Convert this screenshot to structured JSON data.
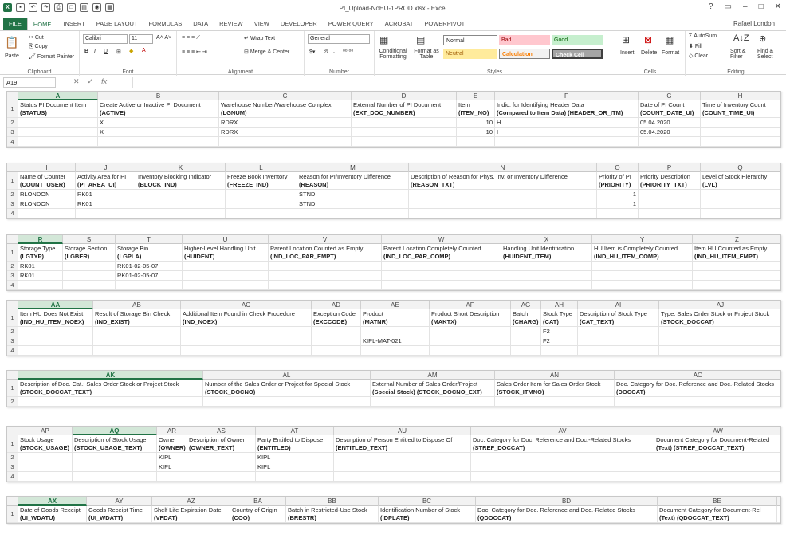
{
  "window": {
    "title": "PI_Upload-NoHU-1PROD.xlsx - Excel",
    "user": "Rafael London",
    "controls": [
      "?",
      "▭",
      "–",
      "□",
      "✕"
    ]
  },
  "tabs": [
    "FILE",
    "HOME",
    "INSERT",
    "PAGE LAYOUT",
    "FORMULAS",
    "DATA",
    "REVIEW",
    "VIEW",
    "DEVELOPER",
    "POWER QUERY",
    "ACROBAT",
    "POWERPIVOT"
  ],
  "active_tab": "HOME",
  "ribbon": {
    "clipboard": {
      "paste": "Paste",
      "cut": "Cut",
      "copy": "Copy",
      "format_painter": "Format Painter",
      "label": "Clipboard"
    },
    "font": {
      "name": "Calibri",
      "size": "11",
      "label": "Font"
    },
    "alignment": {
      "wrap": "Wrap Text",
      "merge": "Merge & Center",
      "label": "Alignment"
    },
    "number": {
      "format": "General",
      "label": "Number",
      "pct": "%",
      "comma": ","
    },
    "styles": {
      "cond": "Conditional Formatting",
      "table": "Format as Table",
      "normal": "Normal",
      "bad": "Bad",
      "good": "Good",
      "neutral": "Neutral",
      "calculation": "Calculation",
      "check": "Check Cell",
      "label": "Styles"
    },
    "cells": {
      "insert": "Insert",
      "delete": "Delete",
      "format": "Format",
      "label": "Cells"
    },
    "editing": {
      "autosum": "AutoSum",
      "fill": "Fill",
      "clear": "Clear",
      "sort": "Sort & Filter",
      "find": "Find & Select",
      "label": "Editing"
    }
  },
  "formula_bar": {
    "name_box": "A19",
    "fx": "fx",
    "value": ""
  },
  "blocks": [
    {
      "cols": [
        "A",
        "B",
        "C",
        "D",
        "E",
        "F",
        "G",
        "H"
      ],
      "sel": 0,
      "widths": [
        100,
        152,
        166,
        132,
        48,
        180,
        78,
        100
      ],
      "rows": [
        [
          "1",
          [
            "Status PI Document Item",
            "(STATUS)"
          ],
          [
            "Create Active or Inactive PI Document",
            "(ACTIVE)"
          ],
          [
            "Warehouse Number/Warehouse Complex",
            "(LGNUM)"
          ],
          [
            "External Number of PI Document",
            "(EXT_DOC_NUMBER)"
          ],
          [
            "Item",
            "(ITEM_NO)"
          ],
          [
            "Indic. for Identifying Header Data",
            "(Compared to Item Data) (HEADER_OR_ITM)"
          ],
          [
            "Date of PI Count",
            "(COUNT_DATE_UI)"
          ],
          [
            "Time of Inventory Count",
            "(COUNT_TIME_UI)"
          ]
        ],
        [
          "2",
          "",
          "X",
          "RDRX",
          "",
          "10",
          "H",
          "05.04.2020",
          ""
        ],
        [
          "3",
          "",
          "X",
          "RDRX",
          "",
          "10",
          "I",
          "05.04.2020",
          ""
        ],
        [
          "4",
          "",
          "",
          "",
          "",
          "",
          "",
          "",
          ""
        ]
      ]
    },
    {
      "cols": [
        "I",
        "J",
        "K",
        "L",
        "M",
        "N",
        "O",
        "P",
        "Q"
      ],
      "sel": -1,
      "widths": [
        72,
        76,
        112,
        90,
        140,
        236,
        52,
        78,
        100
      ],
      "rows": [
        [
          "1",
          [
            "Name of Counter",
            "(COUNT_USER)"
          ],
          [
            "Activity Area for PI",
            "(PI_AREA_UI)"
          ],
          [
            "Inventory Blocking Indicator",
            "(BLOCK_IND)"
          ],
          [
            "Freeze Book Inventory",
            "(FREEZE_IND)"
          ],
          [
            "Reason for PI/Inventory Difference",
            "(REASON)"
          ],
          [
            "Description of Reason for Phys. Inv. or Inventory Difference",
            "(REASON_TXT)"
          ],
          [
            "Priority of PI",
            "(PRIORITY)"
          ],
          [
            "Priority Description",
            "(PRIORITY_TXT)"
          ],
          [
            "Level of Stock Hierarchy",
            "(LVL)"
          ]
        ],
        [
          "2",
          "RLONDON",
          "RK01",
          "",
          "",
          "STND",
          "",
          "1",
          "",
          ""
        ],
        [
          "3",
          "RLONDON",
          "RK01",
          "",
          "",
          "STND",
          "",
          "1",
          "",
          ""
        ],
        [
          "4",
          "",
          "",
          "",
          "",
          "",
          "",
          "",
          "",
          ""
        ]
      ]
    },
    {
      "cols": [
        "R",
        "S",
        "T",
        "U",
        "V",
        "W",
        "X",
        "Y",
        "Z"
      ],
      "sel": 0,
      "widths": [
        56,
        66,
        84,
        108,
        142,
        150,
        114,
        126,
        112
      ],
      "rows": [
        [
          "1",
          [
            "Storage Type",
            "(LGTYP)"
          ],
          [
            "Storage Section",
            "(LGBER)"
          ],
          [
            "Storage Bin",
            "(LGPLA)"
          ],
          [
            "Higher-Level Handling Unit",
            "(HUIDENT)"
          ],
          [
            "Parent Location Counted as Empty",
            "(IND_LOC_PAR_EMPT)"
          ],
          [
            "Parent Location Completely Counted",
            "(IND_LOC_PAR_COMP)"
          ],
          [
            "Handling Unit Identification",
            "(HUIDENT_ITEM)"
          ],
          [
            "HU Item is Completely Counted",
            "(IND_HU_ITEM_COMP)"
          ],
          [
            "Item HU Counted as Empty",
            "(IND_HU_ITEM_EMPT)"
          ]
        ],
        [
          "2",
          "RK01",
          "",
          "RK01-02-05-07",
          "",
          "",
          "",
          "",
          "",
          ""
        ],
        [
          "3",
          "RK01",
          "",
          "RK01-02-05-07",
          "",
          "",
          "",
          "",
          "",
          ""
        ],
        [
          "4",
          "",
          "",
          "",
          "",
          "",
          "",
          "",
          "",
          ""
        ]
      ]
    },
    {
      "cols": [
        "AA",
        "AB",
        "AC",
        "AD",
        "AE",
        "AF",
        "AG",
        "AH",
        "AI",
        "AJ"
      ],
      "sel": 0,
      "widths": [
        94,
        110,
        164,
        62,
        86,
        102,
        38,
        46,
        102,
        154
      ],
      "rows": [
        [
          "1",
          [
            "Item HU Does Not Exist",
            "(IND_HU_ITEM_NOEX)"
          ],
          [
            "Result of Storage Bin Check",
            "(IND_EXIST)"
          ],
          [
            "Additional Item Found in Check Procedure",
            "(IND_NOEX)"
          ],
          [
            "Exception Code",
            "(EXCCODE)"
          ],
          [
            "Product",
            "(MATNR)"
          ],
          [
            "Product Short Description",
            "(MAKTX)"
          ],
          [
            "Batch",
            "(CHARG)"
          ],
          [
            "Stock Type",
            "(CAT)"
          ],
          [
            "Description of Stock Type",
            "(CAT_TEXT)"
          ],
          [
            "Type: Sales Order Stock or Project Stock",
            "(STOCK_DOCCAT)"
          ]
        ],
        [
          "2",
          "",
          "",
          "",
          "",
          "",
          "",
          "",
          "F2",
          "",
          ""
        ],
        [
          "3",
          "",
          "",
          "",
          "",
          "KIPL-MAT-021",
          "",
          "",
          "F2",
          "",
          ""
        ],
        [
          "4",
          "",
          "",
          "",
          "",
          "",
          "",
          "",
          "",
          "",
          ""
        ]
      ]
    },
    {
      "cols": [
        "AK",
        "AL",
        "AM",
        "AN",
        "AO"
      ],
      "sel": 0,
      "widths": [
        232,
        210,
        156,
        150,
        210
      ],
      "rows": [
        [
          "1",
          [
            "Description of Doc. Cat.: Sales Order Stock or Project Stock",
            "(STOCK_DOCCAT_TEXT)"
          ],
          [
            "Number of the Sales Order or Project for Special Stock",
            "(STOCK_DOCNO)"
          ],
          [
            "External Number of Sales Order/Project",
            "(Special Stock) (STOCK_DOCNO_EXT)"
          ],
          [
            "Sales Order Item for Sales Order Stock",
            "(STOCK_ITMNO)"
          ],
          [
            "Doc. Category for Doc. Reference and Doc.-Related Stocks",
            "(DOCCAT)"
          ]
        ],
        [
          "2",
          "",
          "",
          "",
          "",
          ""
        ]
      ]
    },
    {
      "cols": [
        "AP",
        "AQ",
        "AR",
        "AS",
        "AT",
        "AU",
        "AV",
        "AW"
      ],
      "sel": 1,
      "widths": [
        68,
        106,
        38,
        86,
        98,
        172,
        230,
        160
      ],
      "rows": [
        [
          "1",
          [
            "Stock Usage",
            "(STOCK_USAGE)"
          ],
          [
            "Description of Stock Usage",
            "(STOCK_USAGE_TEXT)"
          ],
          [
            "Owner",
            "(OWNER)"
          ],
          [
            "Description of Owner",
            "(OWNER_TEXT)"
          ],
          [
            "Party Entitled to Dispose",
            "(ENTITLED)"
          ],
          [
            "Description of Person Entitled to Dispose Of",
            "(ENTITLED_TEXT)"
          ],
          [
            "Doc. Category for Doc. Reference and Doc.-Related Stocks",
            "(STREF_DOCCAT)"
          ],
          [
            "Document Category for Document-Related",
            "(Text) (STREF_DOCCAT_TEXT)"
          ]
        ],
        [
          "2",
          "",
          "",
          "KIPL",
          "",
          "KIPL",
          "",
          "",
          ""
        ],
        [
          "3",
          "",
          "",
          "KIPL",
          "",
          "KIPL",
          "",
          "",
          ""
        ],
        [
          "4",
          "",
          "",
          "",
          "",
          "",
          "",
          "",
          ""
        ]
      ]
    },
    {
      "cols": [
        "AX",
        "AY",
        "AZ",
        "BA",
        "BB",
        "BC",
        "BD",
        "BE"
      ],
      "sel": 0,
      "widths": [
        86,
        82,
        98,
        70,
        116,
        122,
        228,
        150
      ],
      "rows": [
        [
          "1",
          [
            "Date of Goods Receipt",
            "(UI_WDATU)"
          ],
          [
            "Goods Receipt Time",
            "(UI_WDATT)"
          ],
          [
            "Shelf Life Expiration Date",
            "(VFDAT)"
          ],
          [
            "Country of Origin",
            "(COO)"
          ],
          [
            "Batch in Restricted-Use Stock",
            "(BRESTR)"
          ],
          [
            "Identification Number of Stock",
            "(IDPLATE)"
          ],
          [
            "Doc. Category for Doc. Reference and Doc.-Related Stocks",
            "(QDOCCAT)"
          ],
          [
            "Document Category for Document-Rel",
            "(Text) (QDOCCAT_TEXT)"
          ]
        ]
      ]
    }
  ]
}
